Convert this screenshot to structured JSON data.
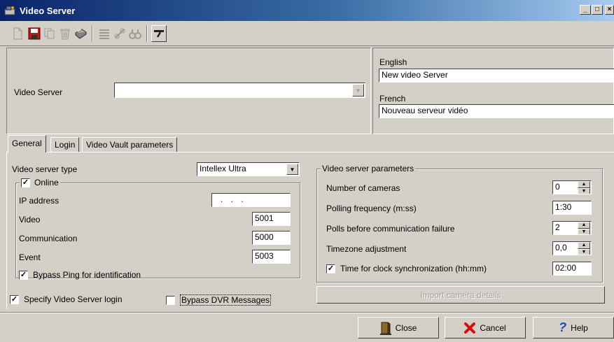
{
  "window": {
    "title": "Video Server"
  },
  "toolbar": {
    "buttons": [
      "new-icon",
      "save-icon",
      "copy-icon",
      "delete-icon",
      "print-icon",
      "list-icon",
      "link-icon",
      "find-icon",
      "filter-icon"
    ]
  },
  "header": {
    "name_label": "Video Server",
    "name_value": "",
    "english_label": "English",
    "english_value": "New video Server",
    "french_label": "French",
    "french_value": "Nouveau serveur vidéo"
  },
  "tabs": [
    {
      "label": "General",
      "active": true
    },
    {
      "label": "Login",
      "active": false
    },
    {
      "label": "Video Vault parameters",
      "active": false
    }
  ],
  "general": {
    "server_type_label": "Video server type",
    "server_type_value": "Intellex Ultra",
    "online_label": "Online",
    "online_checked": true,
    "ip_label": "IP address",
    "ip_value": ". . .",
    "video_label": "Video",
    "video_value": "5001",
    "communication_label": "Communication",
    "communication_value": "5000",
    "event_label": "Event",
    "event_value": "5003",
    "bypass_ping_label": "Bypass Ping for identification",
    "bypass_ping_checked": true,
    "specify_login_label": "Specify Video Server login",
    "specify_login_checked": true,
    "bypass_dvr_label": "Bypass DVR Messages",
    "bypass_dvr_checked": false
  },
  "params": {
    "group_title": "Video server parameters",
    "num_cameras_label": "Number of cameras",
    "num_cameras_value": "0",
    "polling_label": "Polling frequency (m:ss)",
    "polling_value": "1:30",
    "polls_label": "Polls before communication failure",
    "polls_value": "2",
    "timezone_label": "Timezone adjustment",
    "timezone_value": "0,0",
    "clock_sync_label": "Time for clock synchronization (hh:mm)",
    "clock_sync_checked": true,
    "clock_sync_value": "02:00",
    "import_label": "Import camera details"
  },
  "footer": {
    "close_label": "Close",
    "cancel_label": "Cancel",
    "help_label": "Help"
  },
  "colors": {
    "title_start": "#0a246a",
    "title_end": "#a6caf0",
    "face": "#d4d0c8",
    "cancel_icon": "#d01010",
    "help_icon": "#1848c8"
  }
}
